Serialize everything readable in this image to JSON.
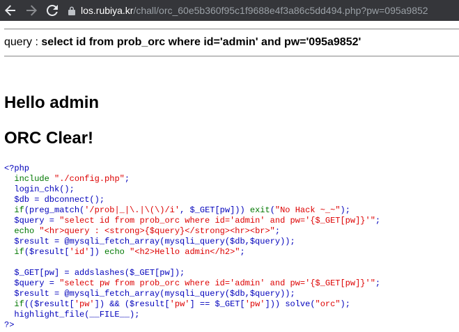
{
  "browser": {
    "back_icon": "arrow-left-icon",
    "forward_icon": "arrow-right-icon",
    "reload_icon": "reload-icon",
    "lock_icon": "lock-icon",
    "url_host": "los.rubiya.kr",
    "url_path": "/chall/orc_60e5b360f95c1f9688e4f3a86c5dd494.php?pw=095a9852"
  },
  "query": {
    "label": "query : ",
    "sql": "select id from prob_orc where id='admin' and pw='095a9852'"
  },
  "headings": {
    "hello": "Hello admin",
    "clear": "ORC Clear!"
  },
  "source": {
    "lines": [
      "<?php",
      "  include \"./config.php\";",
      "  login_chk();",
      "  $db = dbconnect();",
      "  if(preg_match('/prob|_|\\.|\\(\\)/i', $_GET[pw])) exit(\"No Hack ~_~\");",
      "  $query = \"select id from prob_orc where id='admin' and pw='{$_GET[pw]}'\";",
      "  echo \"<hr>query : <strong>{$query}</strong><hr><br>\";",
      "  $result = @mysqli_fetch_array(mysqli_query($db,$query));",
      "  if($result['id']) echo \"<h2>Hello admin</h2>\";",
      "",
      "  $_GET[pw] = addslashes($_GET[pw]);",
      "  $query = \"select pw from prob_orc where id='admin' and pw='{$_GET[pw]}'\";",
      "  $result = @mysqli_fetch_array(mysqli_query($db,$query));",
      "  if(($result['pw']) && ($result['pw'] == $_GET['pw'])) solve(\"orc\");",
      "  highlight_file(__FILE__);",
      "?>"
    ]
  },
  "colors": {
    "chrome_bg": "#35363a",
    "code_default": "#0000bb",
    "code_string": "#dd0000",
    "code_keyword": "#007700"
  }
}
